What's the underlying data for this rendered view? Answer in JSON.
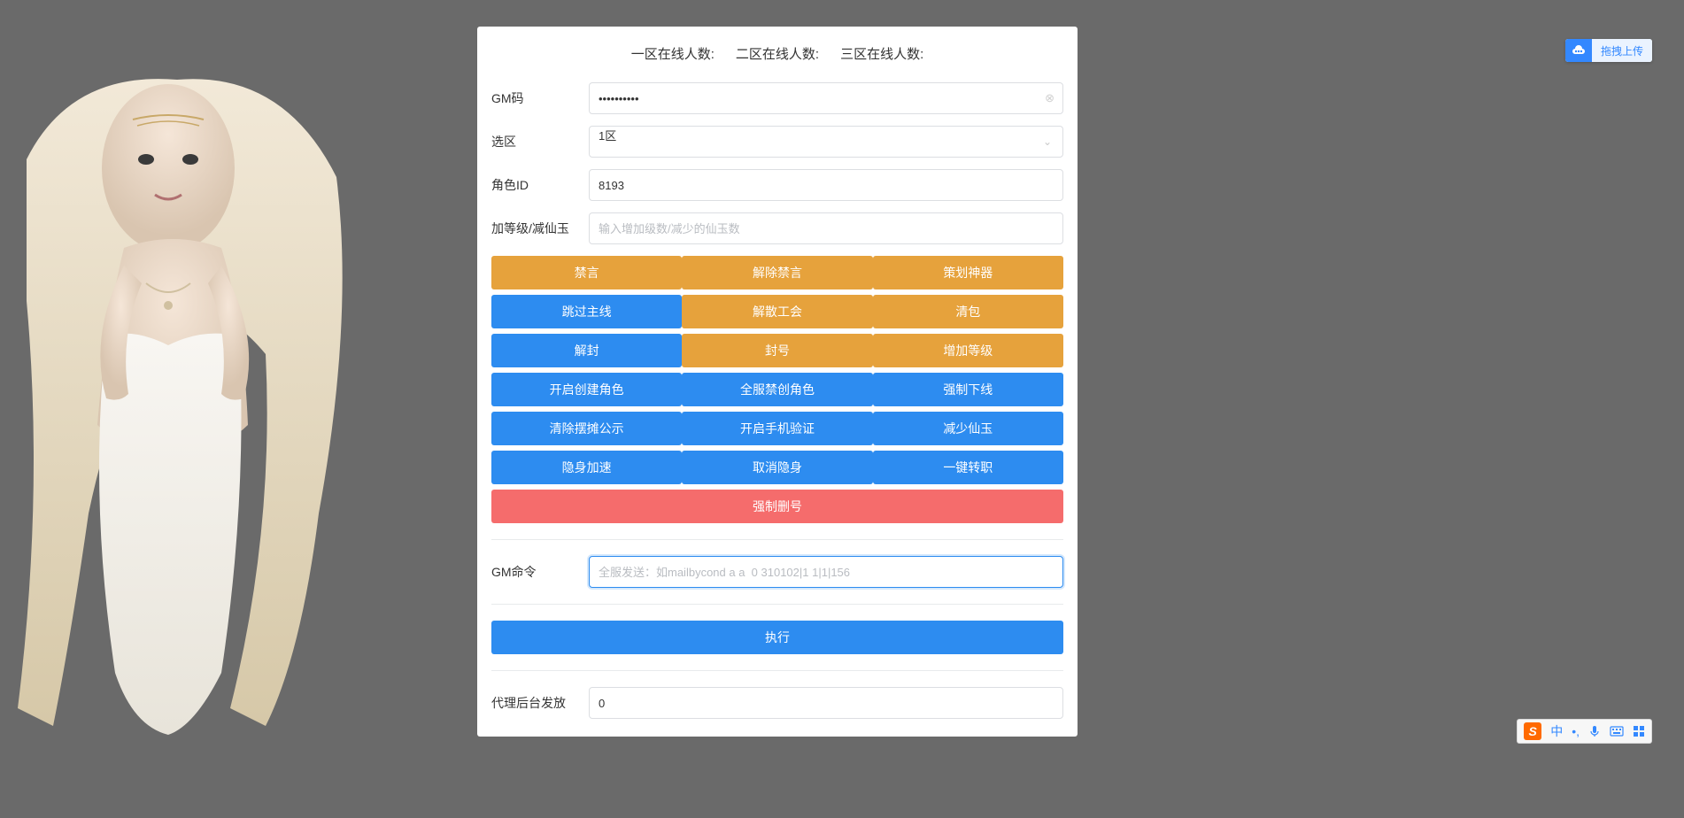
{
  "header": {
    "zone1_label": "一区在线人数:",
    "zone2_label": "二区在线人数:",
    "zone3_label": "三区在线人数:"
  },
  "form": {
    "gmcode": {
      "label": "GM码",
      "value": "••••••••••"
    },
    "zone": {
      "label": "选区",
      "selected": "1区"
    },
    "roleid": {
      "label": "角色ID",
      "value": "8193"
    },
    "level": {
      "label": "加等级/减仙玉",
      "placeholder": "输入增加级数/减少的仙玉数"
    },
    "gmcmd": {
      "label": "GM命令",
      "placeholder": "全服发送：如mailbycond a a  0 310102|1 1|1|156"
    },
    "agent": {
      "label": "代理后台发放",
      "value": "0"
    }
  },
  "buttons": {
    "row1": [
      "禁言",
      "解除禁言",
      "策划神器"
    ],
    "row2": [
      "跳过主线",
      "解散工会",
      "清包"
    ],
    "row3": [
      "解封",
      "封号",
      "增加等级"
    ],
    "row4": [
      "开启创建角色",
      "全服禁创角色",
      "强制下线"
    ],
    "row5": [
      "清除摆摊公示",
      "开启手机验证",
      "减少仙玉"
    ],
    "row6": [
      "隐身加速",
      "取消隐身",
      "一键转职"
    ],
    "row7": "强制删号",
    "execute": "执行"
  },
  "upload": {
    "label": "拖拽上传"
  },
  "ime": {
    "lang": "中"
  }
}
